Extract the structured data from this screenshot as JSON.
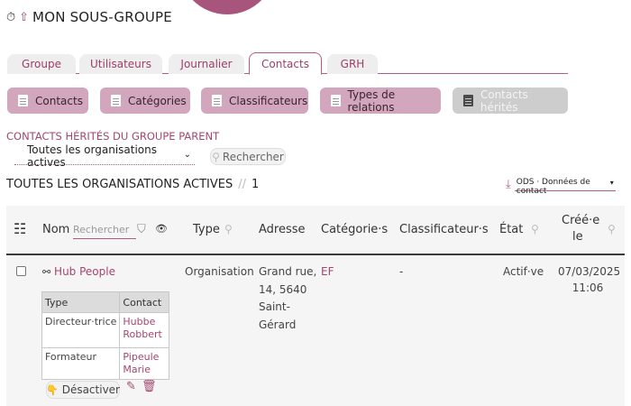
{
  "header": {
    "title": "MON SOUS-GROUPE",
    "icons": [
      "stopwatch-icon",
      "anchor-icon"
    ],
    "accent_color": "#a8557e"
  },
  "tabs": [
    {
      "label": "Groupe",
      "active": false
    },
    {
      "label": "Utilisateurs",
      "active": false
    },
    {
      "label": "Journalier",
      "active": false
    },
    {
      "label": "Contacts",
      "active": true
    },
    {
      "label": "GRH",
      "active": false
    }
  ],
  "subtabs": [
    {
      "label": "Contacts",
      "icon": "document-icon",
      "disabled": false
    },
    {
      "label": "Catégories",
      "icon": "document-icon",
      "disabled": false
    },
    {
      "label": "Classificateurs",
      "icon": "document-icon",
      "disabled": false
    },
    {
      "label": "Types de relations",
      "icon": "document-icon",
      "disabled": false
    },
    {
      "label": "Contacts hérités",
      "icon": "document-icon",
      "disabled": true
    }
  ],
  "filter": {
    "section_label": "CONTACTS HÉRITÉS DU GROUPE PARENT",
    "org_select_value": "Toutes les organisations actives",
    "search_button": "Rechercher"
  },
  "results": {
    "label": "TOUTES LES ORGANISATIONS ACTIVES",
    "separator": "//",
    "count": "1",
    "export_value": "ODS · Données de contact"
  },
  "table": {
    "columns": {
      "nom": "Nom",
      "nom_search_placeholder": "Rechercher",
      "type": "Type",
      "adresse": "Adresse",
      "categories": "Catégorie·s",
      "classificateurs": "Classificateur·s",
      "etat": "État",
      "cree_line1": "Créé·e",
      "cree_line2": "le"
    },
    "row": {
      "name": "Hub People",
      "type": "Organisation",
      "address_lines": [
        "Grand rue,",
        "14, 5640",
        "Saint-",
        "Gérard"
      ],
      "category": "EF",
      "classifier": "-",
      "state": "Actif·ve",
      "created_date": "07/03/2025",
      "created_time": "11:06",
      "relations_header": {
        "type": "Type",
        "contact": "Contact"
      },
      "relations": [
        {
          "type": "Directeur·trice",
          "contact_lines": [
            "Hubbe",
            "Robbert"
          ]
        },
        {
          "type": "Formateur",
          "contact_lines": [
            "Pipeule Marie"
          ]
        }
      ],
      "deactivate_label": "Désactiver"
    }
  }
}
